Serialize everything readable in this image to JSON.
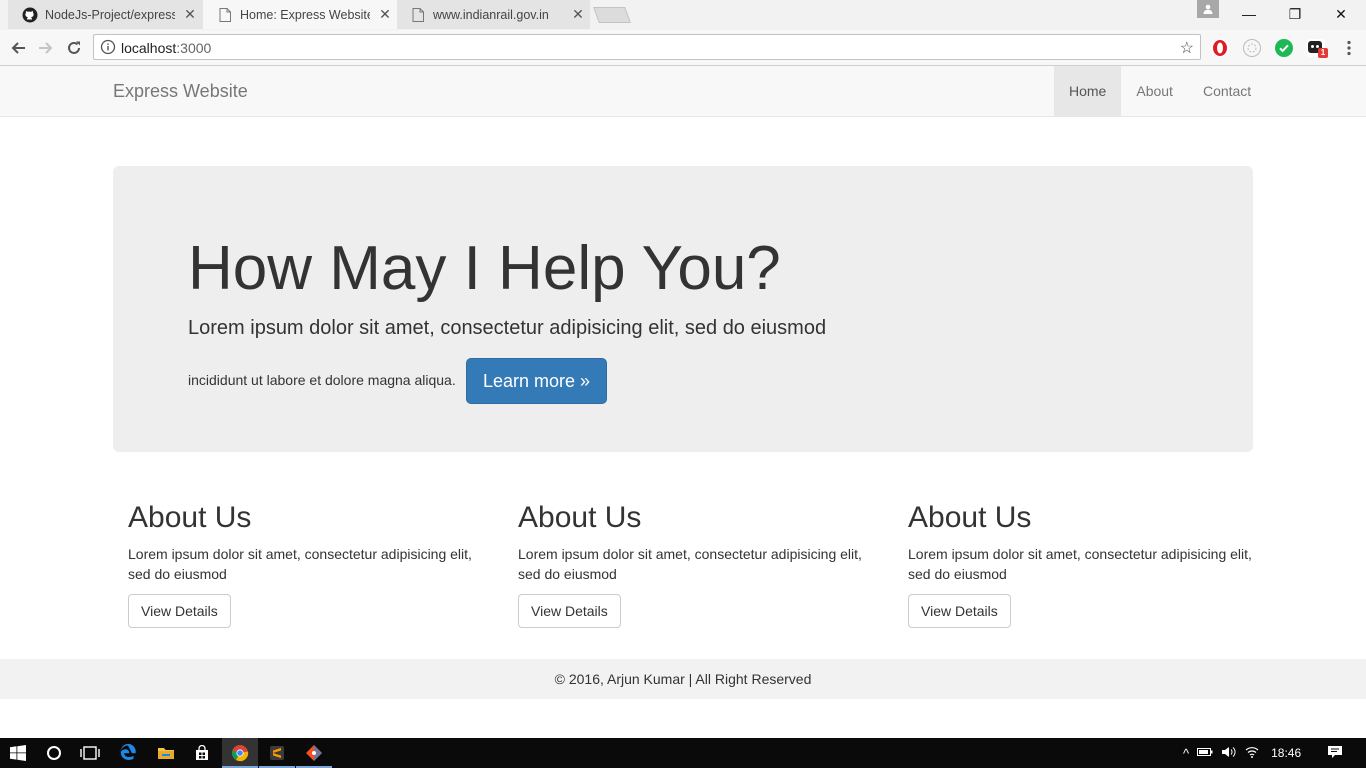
{
  "browser": {
    "tabs": [
      {
        "title": "NodeJs-Project/express_",
        "icon": "github-icon",
        "close": "✕"
      },
      {
        "title": "Home: Express Website",
        "icon": "document-icon",
        "close": "✕"
      },
      {
        "title": "www.indianrail.gov.in",
        "icon": "document-icon",
        "close": "✕"
      }
    ],
    "window_controls": {
      "minimize": "—",
      "restore": "❐",
      "close": "✕"
    },
    "address_bar": {
      "host": "localhost",
      "port": ":3000"
    },
    "extensions": [
      "opera-icon",
      "extension-gray-icon",
      "checkmark-green-icon",
      "extension-badge-icon"
    ],
    "extension_badge": "1"
  },
  "site": {
    "brand": "Express Website",
    "nav": [
      {
        "label": "Home",
        "active": true
      },
      {
        "label": "About",
        "active": false
      },
      {
        "label": "Contact",
        "active": false
      }
    ],
    "jumbotron": {
      "heading": "How May I Help You?",
      "lead": "Lorem ipsum dolor sit amet, consectetur adipisicing elit, sed do eiusmod",
      "text": "incididunt ut labore et dolore magna aliqua.",
      "button": "Learn more »"
    },
    "columns": [
      {
        "heading": "About Us",
        "text": "Lorem ipsum dolor sit amet, consectetur adipisicing elit, sed do eiusmod",
        "button": "View Details"
      },
      {
        "heading": "About Us",
        "text": "Lorem ipsum dolor sit amet, consectetur adipisicing elit, sed do eiusmod",
        "button": "View Details"
      },
      {
        "heading": "About Us",
        "text": "Lorem ipsum dolor sit amet, consectetur adipisicing elit, sed do eiusmod",
        "button": "View Details"
      }
    ],
    "footer": "© 2016, Arjun Kumar | All Right Reserved"
  },
  "taskbar": {
    "apps": [
      "windows-start-icon",
      "cortana-icon",
      "task-view-icon",
      "edge-icon",
      "file-explorer-icon",
      "store-icon",
      "chrome-icon",
      "sublime-icon",
      "git-icon"
    ],
    "clock": "18:46"
  },
  "colors": {
    "primary": "#337ab7",
    "jumbotron_bg": "#eeeeee",
    "navbar_bg": "#f8f8f8"
  }
}
